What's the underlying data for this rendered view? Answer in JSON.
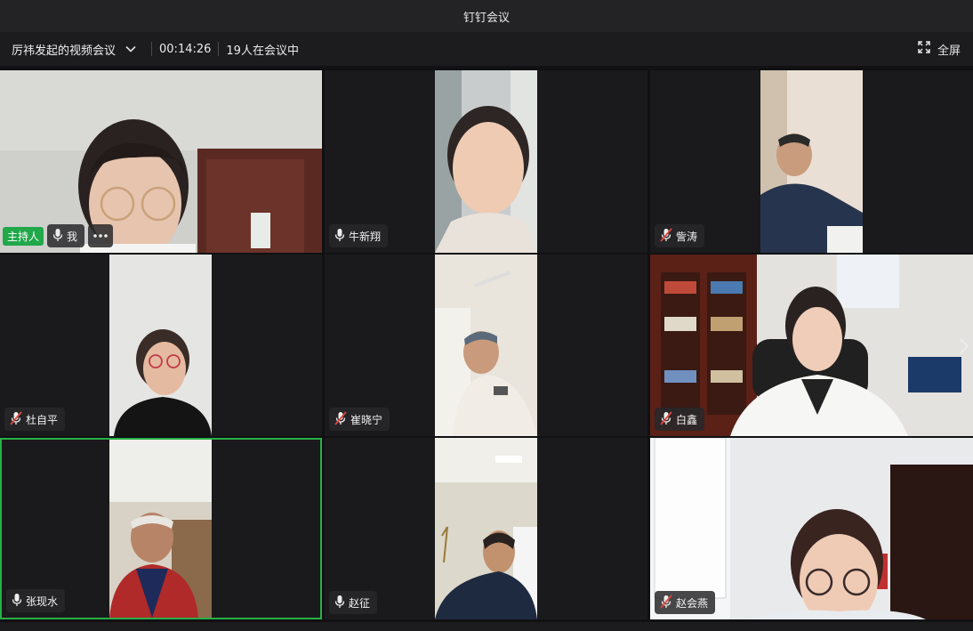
{
  "window": {
    "title": "钉钉会议"
  },
  "toolbar": {
    "meeting_title": "厉祎发起的视频会议",
    "timer": "00:14:26",
    "participant_count": "19人在会议中",
    "fullscreen_label": "全屏"
  },
  "colors": {
    "accent_green": "#21a84a",
    "active_border": "#27b046",
    "muted_red": "#e0453b"
  },
  "participants": [
    {
      "name": "我",
      "host_badge": "主持人",
      "mic": "on"
    },
    {
      "name": "牛新翔",
      "mic": "on"
    },
    {
      "name": "訾涛",
      "mic": "muted"
    },
    {
      "name": "杜自平",
      "mic": "muted"
    },
    {
      "name": "崔晓宁",
      "mic": "muted"
    },
    {
      "name": "白鑫",
      "mic": "muted"
    },
    {
      "name": "张现水",
      "mic": "on",
      "active_speaker": true
    },
    {
      "name": "赵征",
      "mic": "on"
    },
    {
      "name": "赵会燕",
      "mic": "muted"
    }
  ]
}
